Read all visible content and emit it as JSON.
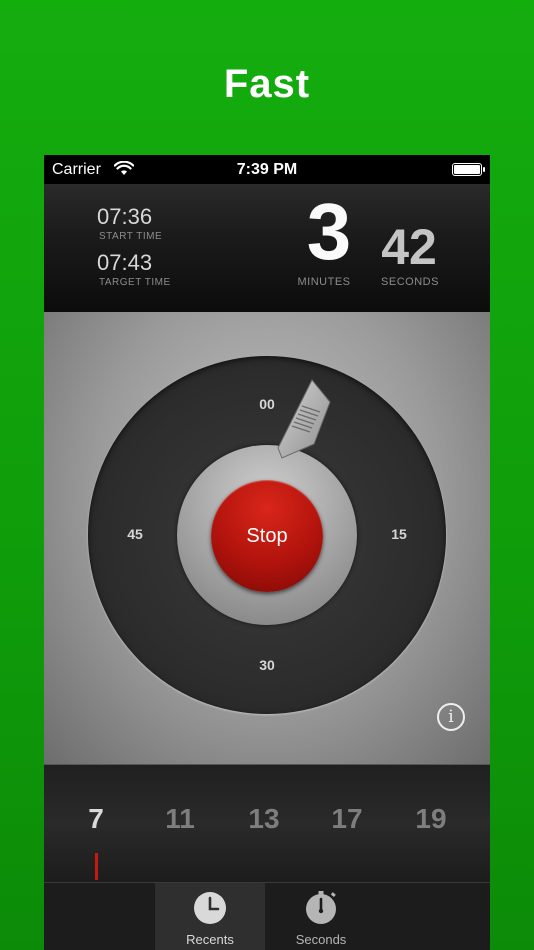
{
  "headline": "Fast",
  "status": {
    "carrier": "Carrier",
    "time": "7:39 PM"
  },
  "info": {
    "start_time": "07:36",
    "start_label": "START TIME",
    "target_time": "07:43",
    "target_label": "TARGET TIME",
    "minutes": "3",
    "minutes_label": "MINUTES",
    "seconds": "42",
    "seconds_label": "SECONDS"
  },
  "dial": {
    "marks": {
      "top": "00",
      "right": "15",
      "bottom": "30",
      "left": "45"
    },
    "stop_label": "Stop",
    "info_label": "i"
  },
  "recents": {
    "items": [
      "7",
      "11",
      "13",
      "17",
      "19"
    ],
    "selected_index": 0,
    "accent_color": "#c41b10"
  },
  "tabs": [
    {
      "label": "Recents",
      "icon": "clock-icon",
      "selected": true
    },
    {
      "label": "Seconds",
      "icon": "stopwatch-icon",
      "selected": false
    }
  ],
  "colors": {
    "background": "#14ad0e",
    "stop_button": "#b1130c"
  }
}
